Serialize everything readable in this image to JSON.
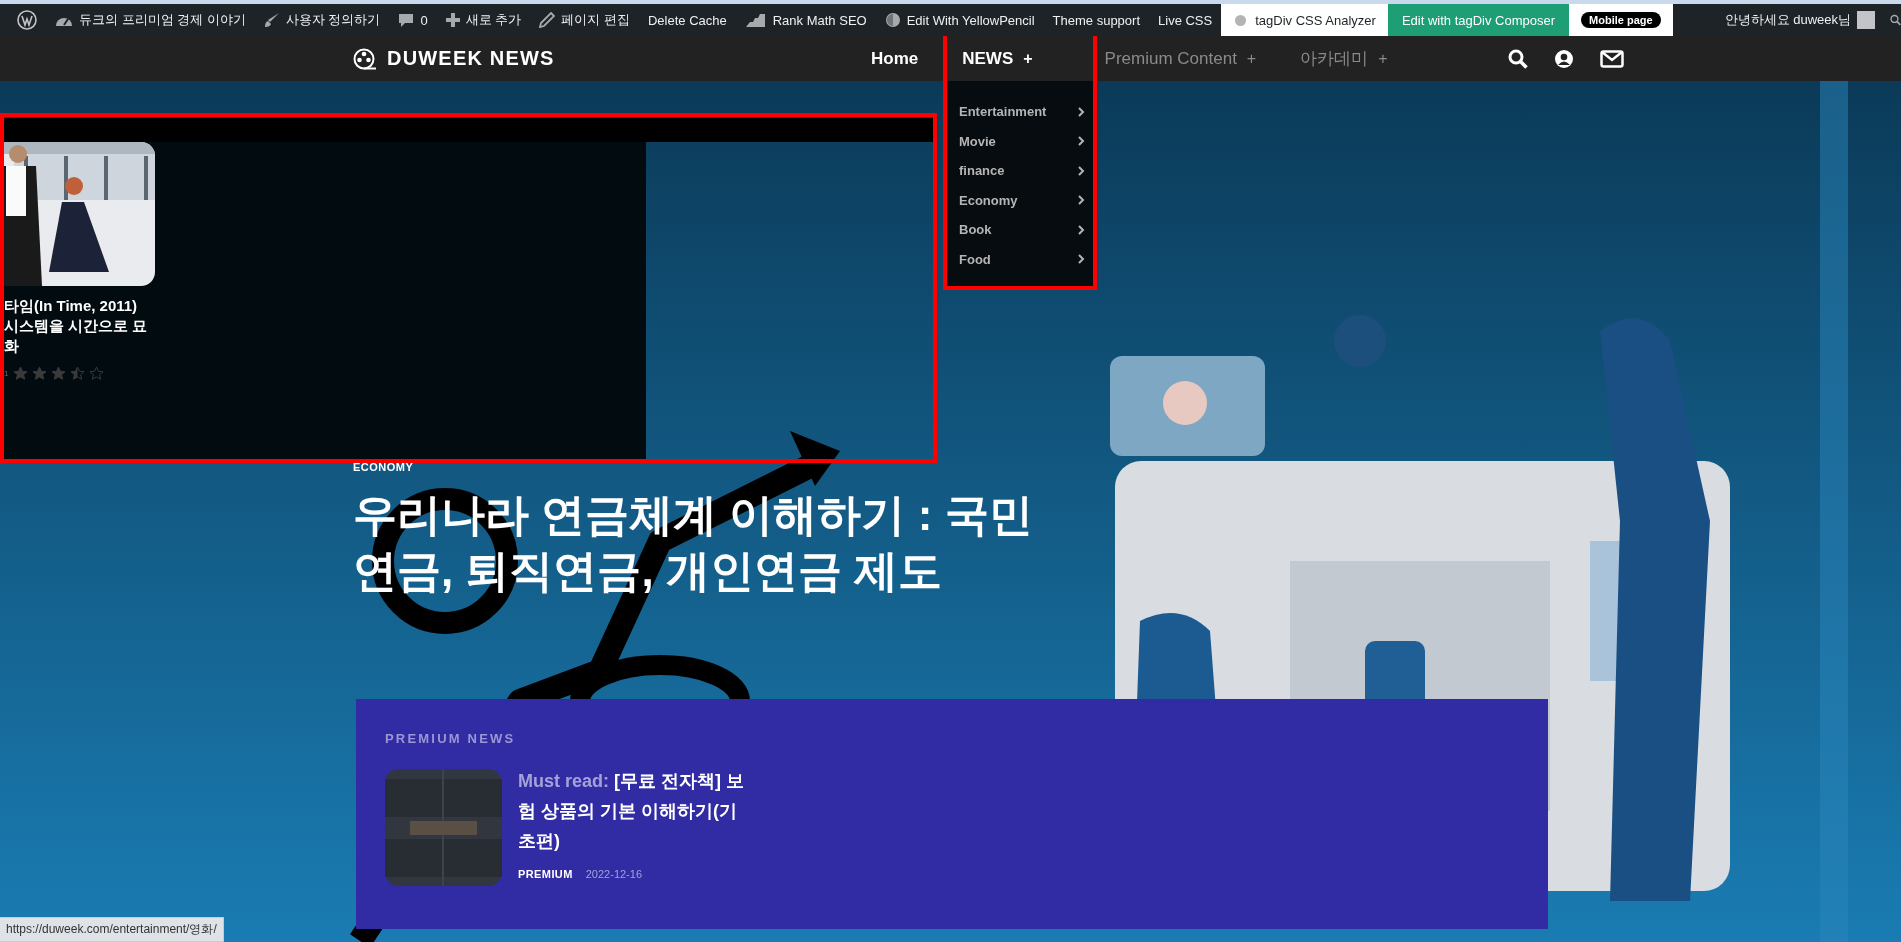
{
  "admin_bar": {
    "site_name": "듀크의 프리미엄 경제 이야기",
    "customize": "사용자 정의하기",
    "comments": "0",
    "new_item": "새로 추가",
    "edit_page": "페이지 편집",
    "delete_cache": "Delete Cache",
    "rank_math": "Rank Math SEO",
    "yellow_pencil": "Edit With YellowPencil",
    "theme_support": "Theme support",
    "live_css": "Live CSS",
    "css_analyzer": "tagDiv CSS Analyzer",
    "composer": "Edit with tagDiv Composer",
    "mobile_page": "Mobile page",
    "greeting": "안녕하세요 duweek님"
  },
  "header": {
    "logo": "DUWEEK NEWS",
    "menu": [
      {
        "label": "Home",
        "dimmed": false
      },
      {
        "label": "NEWS",
        "toggle": "+",
        "dimmed": false
      },
      {
        "label": "Premium Content",
        "toggle": "+",
        "dimmed": true
      },
      {
        "label": "아카데미",
        "toggle": "+",
        "dimmed": true
      }
    ]
  },
  "dropdown": {
    "items": [
      "Entertainment",
      "Movie",
      "finance",
      "Economy",
      "Book",
      "Food"
    ]
  },
  "overlay": {
    "title": "타임(In Time, 2011) 시스템을 시간으로 묘화",
    "rating_label": "1",
    "stars": 3.5
  },
  "hero": {
    "category": "ECONOMY",
    "title": "우리나라 연금체계 이해하기 : 국민연금, 퇴직연금, 개인연금 제도"
  },
  "premium": {
    "heading": "PREMIUM NEWS",
    "posts": [
      {
        "prefix": "Must read:",
        "title": "[무료 전자책] 보험 상품의 기본 이해하기(기초편)",
        "category": "PREMIUM",
        "date": "2022-12-16"
      }
    ]
  },
  "status_url": "https://duweek.com/entertainment/영화/"
}
